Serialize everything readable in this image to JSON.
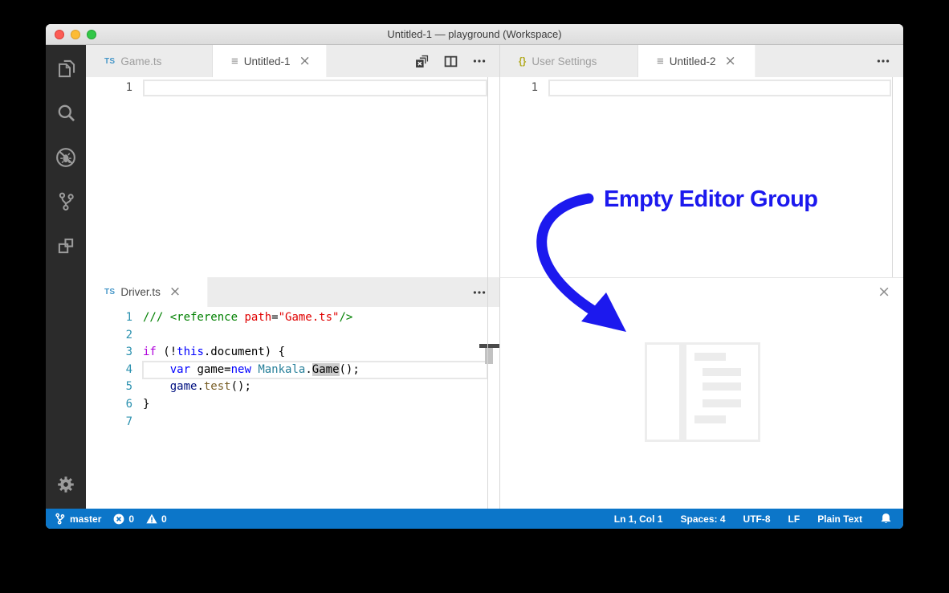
{
  "window": {
    "title": "Untitled-1 — playground (Workspace)"
  },
  "activity_bar": {
    "items": [
      "explorer",
      "search",
      "debug",
      "source-control",
      "extensions"
    ],
    "settings": "settings"
  },
  "groups": {
    "top_left": {
      "tabs": [
        {
          "icon": "TS",
          "label": "Game.ts",
          "active": false
        },
        {
          "icon": "≡",
          "label": "Untitled-1",
          "active": true,
          "close": "×"
        }
      ],
      "actions": {
        "more": "more-actions"
      },
      "gutter_line": "1"
    },
    "top_right": {
      "tabs": [
        {
          "icon": "{}",
          "label": "User Settings",
          "active": false
        },
        {
          "icon": "≡",
          "label": "Untitled-2",
          "active": true,
          "close": "×"
        }
      ],
      "actions": {
        "more": "more-actions"
      },
      "gutter_line": "1"
    },
    "bottom_left": {
      "tabs": [
        {
          "icon": "TS",
          "label": "Driver.ts",
          "active": true,
          "close": "×"
        }
      ],
      "actions": {
        "more": "more-actions"
      },
      "code": {
        "lines": [
          {
            "num": "1",
            "tokens": [
              [
                "comment",
                "/// <reference "
              ],
              [
                "attr",
                "path"
              ],
              [
                "plain",
                "="
              ],
              [
                "string",
                "\"Game.ts\""
              ],
              [
                "comment",
                "/>"
              ]
            ]
          },
          {
            "num": "2",
            "tokens": []
          },
          {
            "num": "3",
            "tokens": [
              [
                "keyword_control",
                "if"
              ],
              [
                "plain",
                " (!"
              ],
              [
                "keyword",
                "this"
              ],
              [
                "plain",
                ".document) {"
              ]
            ]
          },
          {
            "num": "4",
            "current": true,
            "tokens": [
              [
                "plain",
                "    "
              ],
              [
                "keyword",
                "var"
              ],
              [
                "plain",
                " game="
              ],
              [
                "keyword",
                "new"
              ],
              [
                "plain",
                " "
              ],
              [
                "type",
                "Mankala"
              ],
              [
                "plain",
                "."
              ],
              [
                "highlight",
                "Game"
              ],
              [
                "plain",
                "();"
              ]
            ]
          },
          {
            "num": "5",
            "tokens": [
              [
                "plain",
                "    "
              ],
              [
                "variable",
                "game"
              ],
              [
                "plain",
                "."
              ],
              [
                "method",
                "test"
              ],
              [
                "plain",
                "();"
              ]
            ]
          },
          {
            "num": "6",
            "tokens": [
              [
                "plain",
                "}"
              ]
            ]
          },
          {
            "num": "7",
            "tokens": []
          }
        ]
      }
    },
    "bottom_right": {
      "close": "×",
      "watermark": "empty-editor-group-graphic"
    }
  },
  "annotation": {
    "label": "Empty Editor Group",
    "color": "#1c19ee"
  },
  "status_bar": {
    "background": "#0c76c9",
    "left": [
      {
        "icon": "git-branch",
        "label": "master"
      },
      {
        "icon": "error",
        "label": "0"
      },
      {
        "icon": "warning",
        "label": "0"
      }
    ],
    "right": [
      {
        "label": "Ln 1, Col 1"
      },
      {
        "label": "Spaces: 4"
      },
      {
        "label": "UTF-8"
      },
      {
        "label": "LF"
      },
      {
        "label": "Plain Text"
      }
    ],
    "bell": "notifications-bell"
  },
  "syntax_colors": {
    "comment": "#008000",
    "attr": "#e00000",
    "string": "#e00000",
    "keyword": "#0000ff",
    "keyword_control": "#af00db",
    "type": "#267f99",
    "variable": "#001080",
    "method": "#795e26",
    "plain": "#000000",
    "highlight": "#000000",
    "highlight_bg": "#cdcdcd"
  },
  "icon_colors": {
    "ts": "#4596c8",
    "json": "#b3ab25"
  }
}
